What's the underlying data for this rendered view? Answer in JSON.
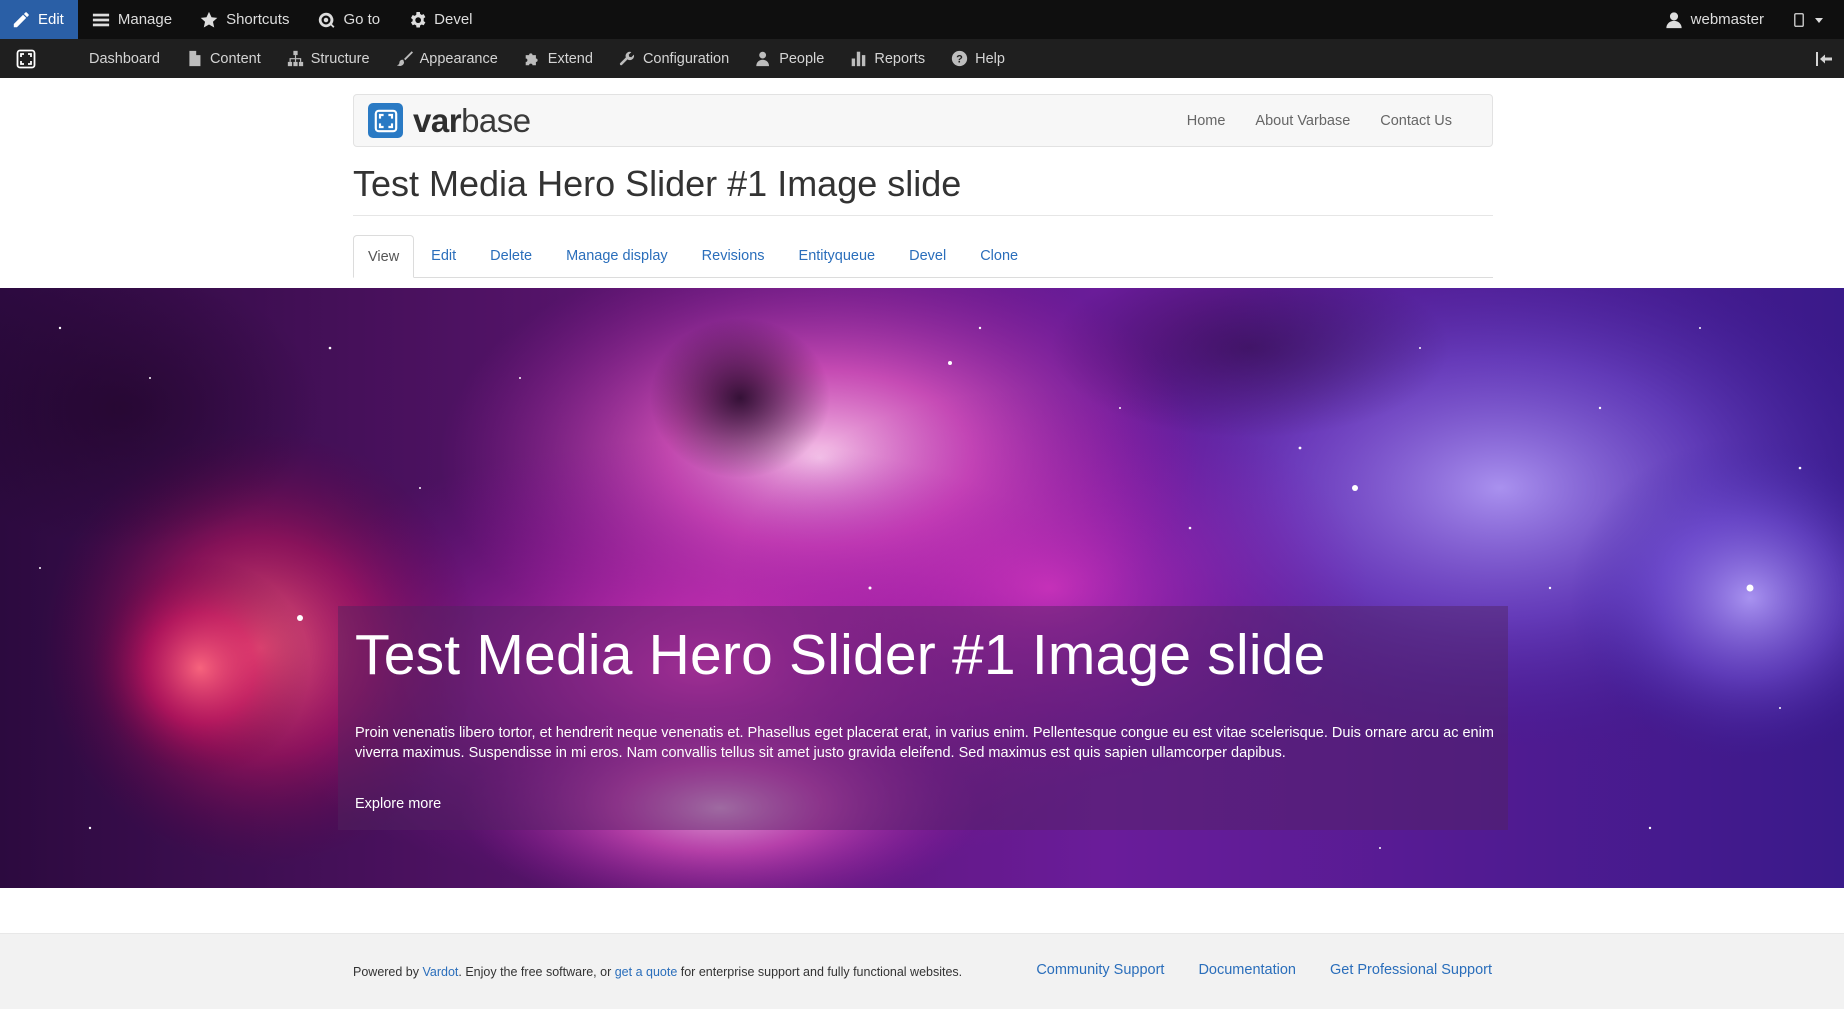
{
  "toolbar": {
    "edit_label": "Edit",
    "manage_label": "Manage",
    "shortcuts_label": "Shortcuts",
    "goto_label": "Go to",
    "devel_label": "Devel",
    "user_label": "webmaster"
  },
  "admin_menu": {
    "items": [
      {
        "label": "Dashboard"
      },
      {
        "label": "Content"
      },
      {
        "label": "Structure"
      },
      {
        "label": "Appearance"
      },
      {
        "label": "Extend"
      },
      {
        "label": "Configuration"
      },
      {
        "label": "People"
      },
      {
        "label": "Reports"
      },
      {
        "label": "Help"
      }
    ]
  },
  "site": {
    "logo_text_bold": "var",
    "logo_text_rest": "base",
    "nav": [
      {
        "label": "Home"
      },
      {
        "label": "About Varbase"
      },
      {
        "label": "Contact Us"
      }
    ]
  },
  "page": {
    "title": "Test Media Hero Slider #1 Image slide",
    "tabs": [
      {
        "label": "View",
        "active": true
      },
      {
        "label": "Edit"
      },
      {
        "label": "Delete"
      },
      {
        "label": "Manage display"
      },
      {
        "label": "Revisions"
      },
      {
        "label": "Entityqueue"
      },
      {
        "label": "Devel"
      },
      {
        "label": "Clone"
      }
    ]
  },
  "hero": {
    "heading": "Test Media Hero Slider #1 Image slide",
    "body": "Proin venenatis libero tortor, et hendrerit neque venenatis et. Phasellus eget placerat erat, in varius enim. Pellentesque congue eu est vitae scelerisque. Duis ornare arcu ac enim viverra maximus. Suspendisse in mi eros. Nam convallis tellus sit amet justo gravida eleifend. Sed maximus est quis sapien ullamcorper dapibus.",
    "link_label": "Explore more"
  },
  "footer": {
    "powered_prefix": "Powered by ",
    "vardot_link": "Vardot",
    "middle_text": ". Enjoy the free software, or ",
    "quote_link": "get a quote",
    "suffix_text": " for enterprise support and fully functional websites.",
    "links": [
      {
        "label": "Community Support"
      },
      {
        "label": "Documentation"
      },
      {
        "label": "Get Professional Support"
      }
    ]
  },
  "colors": {
    "toolbar_dark": "#0f0f0f",
    "toolbar_tray": "#1f1f1f",
    "active_blue": "#2a5fa6",
    "link_blue": "#2a6ebb",
    "logo_blue": "#2a7ac4"
  }
}
